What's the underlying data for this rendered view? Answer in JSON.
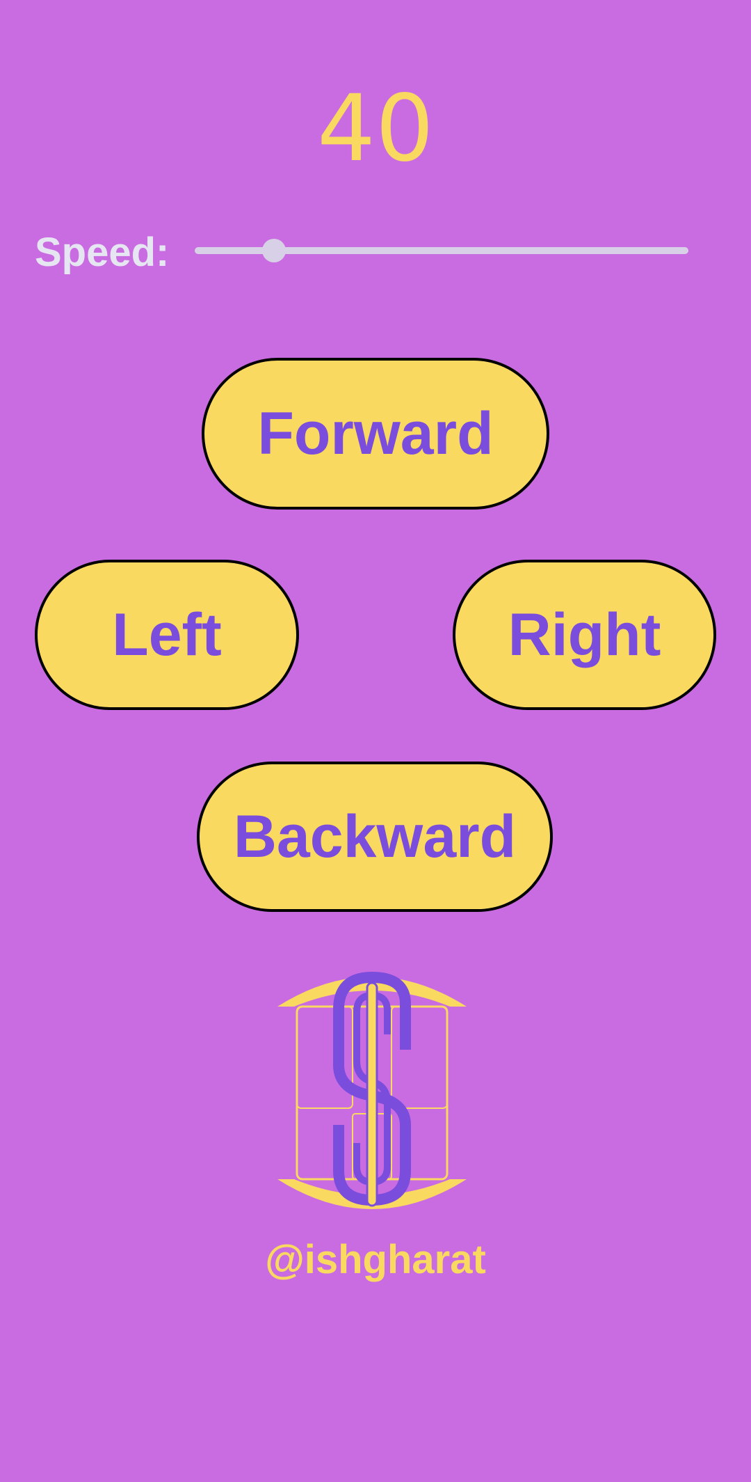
{
  "speed": {
    "value": "40",
    "label": "Speed:",
    "slider_fraction": 0.16
  },
  "controls": {
    "forward_label": "Forward",
    "left_label": "Left",
    "right_label": "Right",
    "backward_label": "Backward"
  },
  "footer": {
    "handle": "@ishgharat"
  },
  "colors": {
    "background": "#c96ce2",
    "accent_yellow": "#fad960",
    "accent_purple": "#7b4ddc",
    "slider": "#d8d0e6"
  },
  "icons": {
    "logo": "s-monogram-logo"
  }
}
